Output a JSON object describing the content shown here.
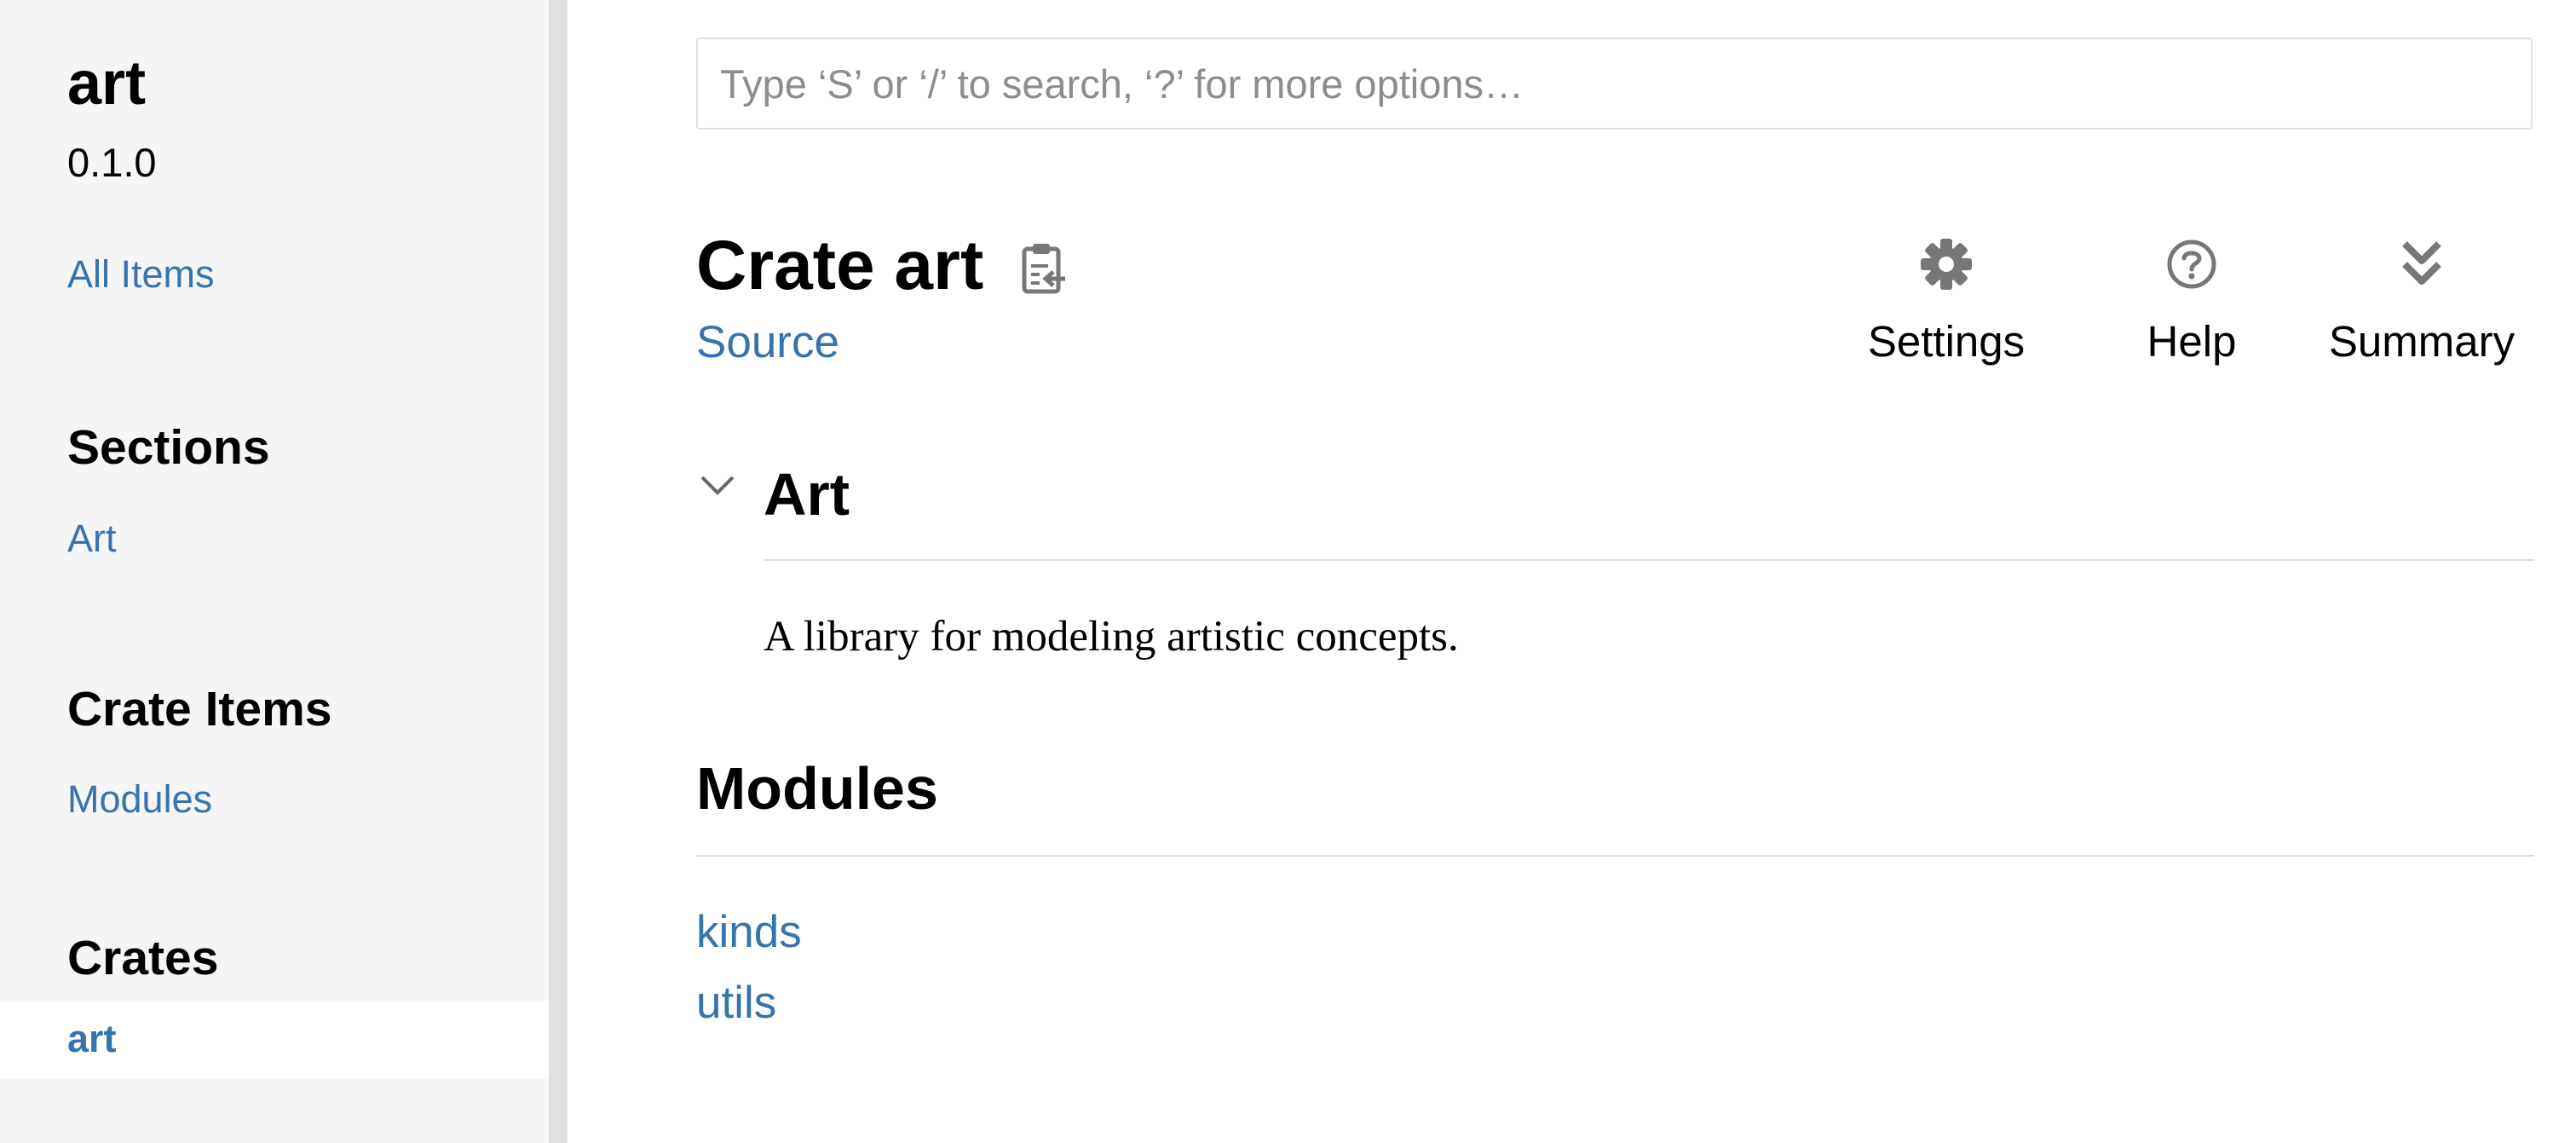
{
  "sidebar": {
    "crate_name": "art",
    "version": "0.1.0",
    "all_items_label": "All Items",
    "sections_heading": "Sections",
    "sections": [
      {
        "label": "Art"
      }
    ],
    "crate_items_heading": "Crate Items",
    "crate_items": [
      {
        "label": "Modules"
      }
    ],
    "crates_heading": "Crates",
    "crates": [
      {
        "label": "art",
        "current": true
      }
    ]
  },
  "search": {
    "placeholder": "Type ‘S’ or ‘/’ to search, ‘?’ for more options…",
    "value": ""
  },
  "main": {
    "title": "Crate art",
    "copy_icon": "clipboard-copy-icon",
    "source_label": "Source",
    "toolbar": [
      {
        "label": "Settings",
        "icon": "gear-icon"
      },
      {
        "label": "Help",
        "icon": "question-circle-icon"
      },
      {
        "label": "Summary",
        "icon": "double-chevron-down-icon"
      }
    ],
    "section_art": {
      "title": "Art",
      "expanded": true,
      "description": "A library for modeling artistic concepts."
    },
    "modules_heading": "Modules",
    "modules": [
      {
        "label": "kinds"
      },
      {
        "label": "utils"
      }
    ]
  },
  "colors": {
    "link": "#3873ad",
    "sidebar_background": "#f5f5f5",
    "sidebar_border": "#e0e0e0",
    "icon_gray": "#777777"
  }
}
